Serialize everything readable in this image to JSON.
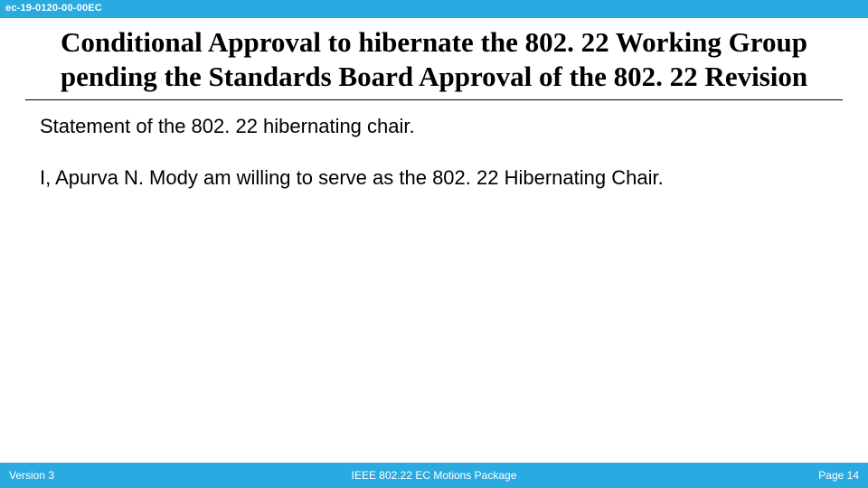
{
  "header": {
    "doc_id": "ec-19-0120-00-00EC"
  },
  "title": "Conditional Approval to hibernate the 802. 22 Working Group pending the Standards Board Approval of the 802. 22 Revision",
  "body": {
    "line1": "Statement of the 802. 22 hibernating chair.",
    "line2": "I, Apurva N. Mody am willing to serve as the 802. 22 Hibernating Chair."
  },
  "footer": {
    "version": "Version 3",
    "center": "IEEE 802.22 EC Motions Package",
    "page": "Page 14"
  },
  "colors": {
    "accent": "#29abe2"
  }
}
